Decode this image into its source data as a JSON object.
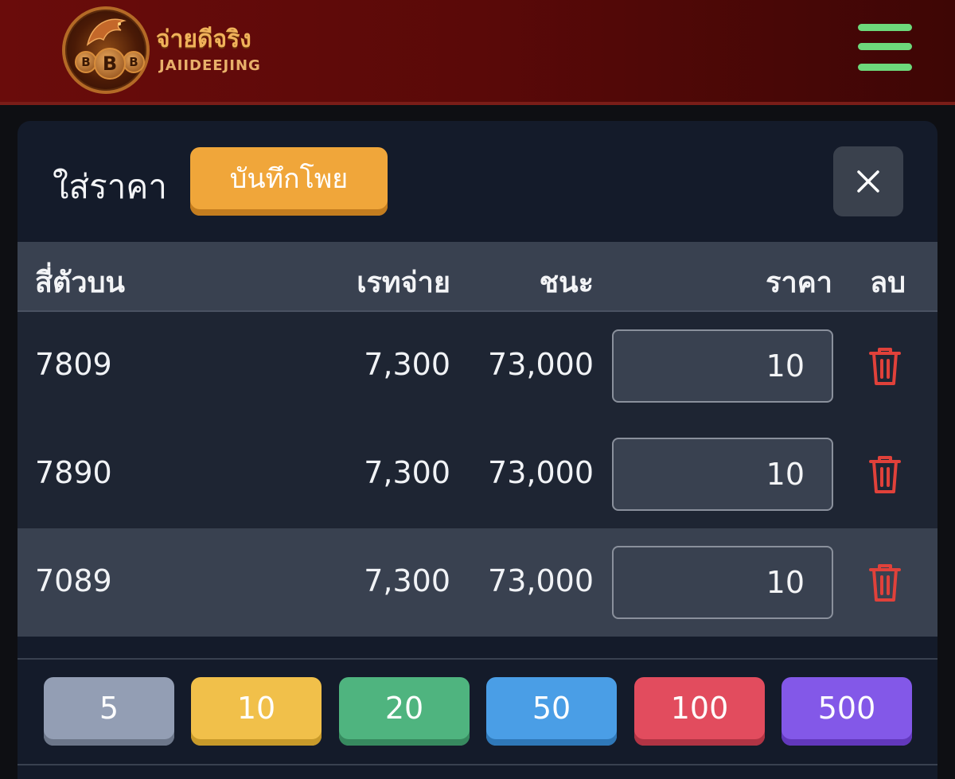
{
  "header": {
    "logo_thai": "จ่ายดีจริง",
    "logo_latin": "JAIIDEEJING",
    "coin_symbol": "B",
    "menu_icon": "hamburger-menu-icon"
  },
  "panel": {
    "title": "ใส่ราคา",
    "save_label": "บันทึกโพย",
    "close_icon": "close-icon"
  },
  "table": {
    "headers": {
      "number": "สี่ตัวบน",
      "rate": "เรทจ่าย",
      "win": "ชนะ",
      "price": "ราคา",
      "delete": "ลบ"
    },
    "rows": [
      {
        "number": "7809",
        "rate": "7,300",
        "win": "73,000",
        "price": "10"
      },
      {
        "number": "7890",
        "rate": "7,300",
        "win": "73,000",
        "price": "10"
      },
      {
        "number": "7089",
        "rate": "7,300",
        "win": "73,000",
        "price": "10"
      }
    ],
    "delete_icon": "trash-icon"
  },
  "chips": [
    {
      "label": "5",
      "color": "#939eb4",
      "shade": "#6c7689"
    },
    {
      "label": "10",
      "color": "#f1c04a",
      "shade": "#c89a2a"
    },
    {
      "label": "20",
      "color": "#4fb47f",
      "shade": "#378a5f"
    },
    {
      "label": "50",
      "color": "#4a9ee6",
      "shade": "#2f78b8"
    },
    {
      "label": "100",
      "color": "#e24c5e",
      "shade": "#b13444"
    },
    {
      "label": "500",
      "color": "#8358e8",
      "shade": "#6238bc"
    }
  ],
  "colors": {
    "accent_orange": "#f0a63a",
    "menu_green": "#6dd97b",
    "delete_red": "#e0413a",
    "header_red": "#5a0908"
  }
}
